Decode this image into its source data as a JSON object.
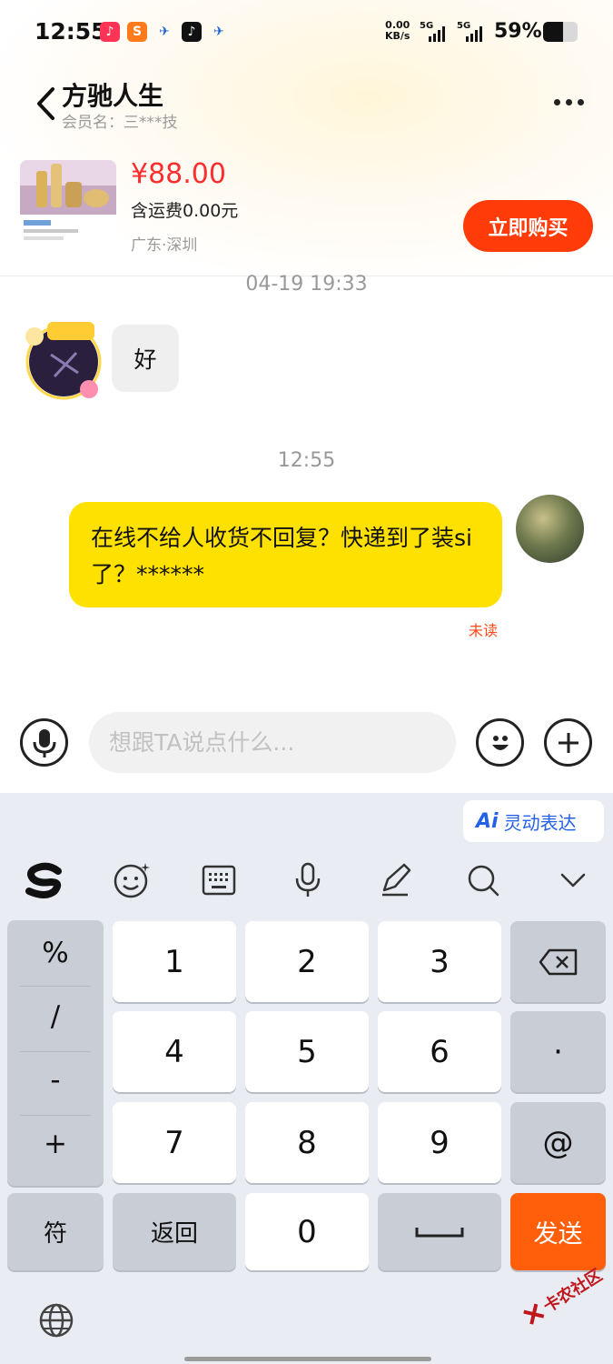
{
  "status": {
    "time": "12:55",
    "net_speed_value": "0.00",
    "net_speed_unit": "KB/s",
    "network1": "5G",
    "network2": "5G",
    "battery": "59%",
    "battery_level": 0.59
  },
  "header": {
    "shop_name": "方驰人生",
    "member": "会员名：三***技"
  },
  "product": {
    "price": "¥88.00",
    "shipping": "含运费0.00元",
    "location": "广东·深圳",
    "buy_label": "立即购买"
  },
  "chat": {
    "timestamp_1": "04-19 19:33",
    "msg_in": "好",
    "timestamp_2": "12:55",
    "msg_out": "在线不给人收货不回复？快递到了装si了？******",
    "read_status": "未读"
  },
  "composer": {
    "placeholder": "想跟TA说点什么..."
  },
  "keyboard": {
    "ai_label": "灵动表达",
    "ai_badge": "Ai",
    "symbols": [
      "%",
      "/",
      "-",
      "+"
    ],
    "digits": [
      "1",
      "2",
      "3",
      "4",
      "5",
      "6",
      "7",
      "8",
      "9",
      "0"
    ],
    "dot": "·",
    "at": "@",
    "fu": "符",
    "back_label": "返回",
    "send_label": "发送"
  },
  "watermark": "卡农社区",
  "colors": {
    "accent_orange": "#ff5e0a",
    "buy_red": "#ff3b0a",
    "price_red": "#ff2d2d",
    "bubble_yellow": "#ffe100"
  }
}
